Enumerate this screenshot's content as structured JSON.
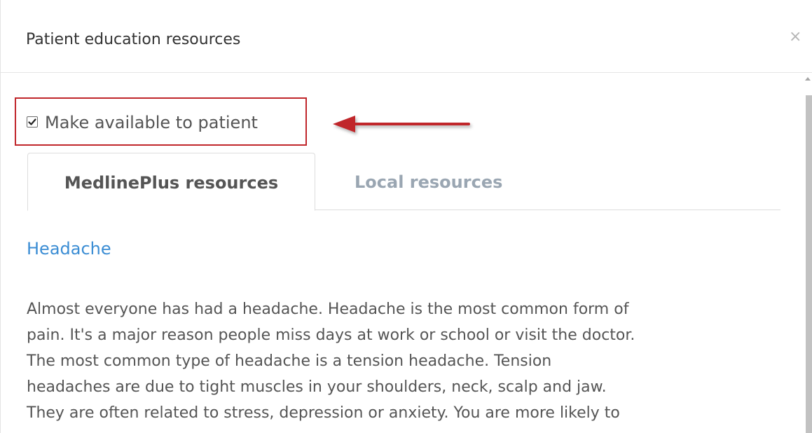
{
  "dialog": {
    "title": "Patient education resources",
    "close_symbol": "×"
  },
  "checkbox": {
    "label": "Make available to patient",
    "checked": true
  },
  "tabs": [
    {
      "label": "MedlinePlus resources",
      "active": true
    },
    {
      "label": "Local resources",
      "active": false
    }
  ],
  "resource": {
    "title": "Headache",
    "body_lines": [
      "Almost everyone has had a headache. Headache is the most common form of",
      "pain. It's a major reason people miss days at work or school or visit the doctor.",
      "The most common type of headache is a tension headache. Tension",
      "headaches are due to tight muscles in your shoulders, neck, scalp and jaw.",
      "They are often related to stress, depression or anxiety. You are more likely to"
    ]
  },
  "colors": {
    "highlight_border": "#c0262b",
    "link": "#3b8dd4",
    "inactive_tab": "#9aa6b2"
  },
  "icons": {
    "close": "close-icon",
    "checkmark": "checkmark-icon",
    "annotation_arrow": "left-arrow-icon",
    "scroll_up": "scroll-up-arrow-icon"
  }
}
